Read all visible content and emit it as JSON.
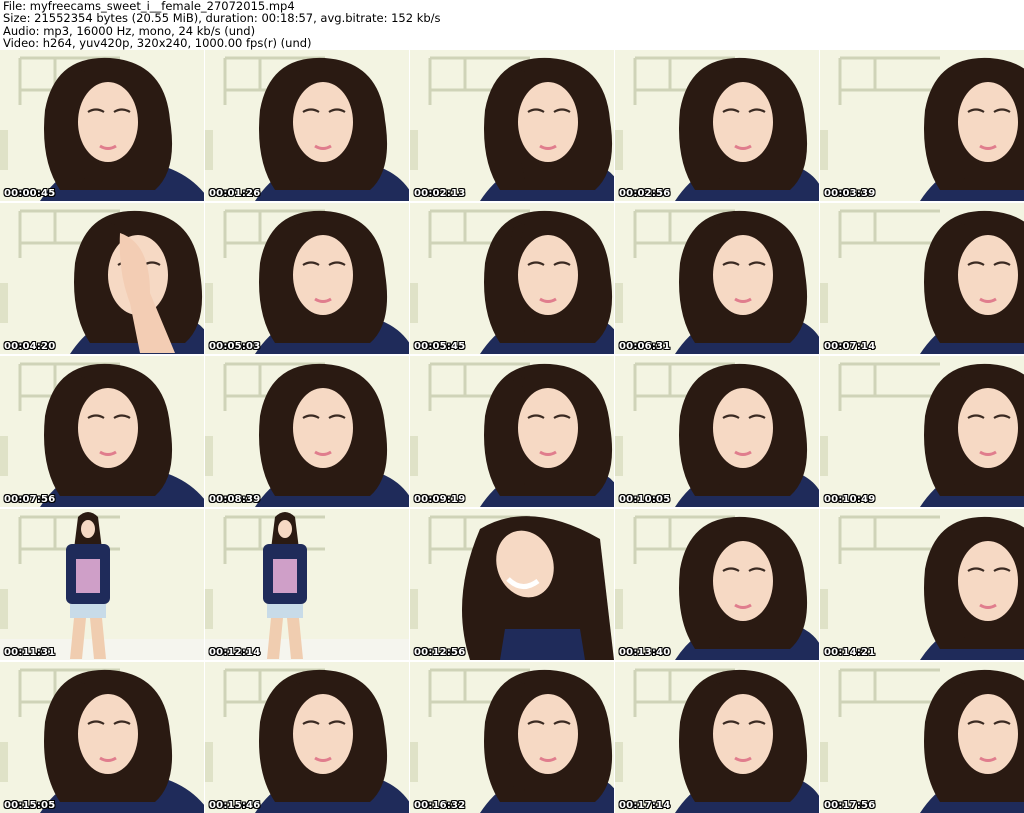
{
  "header": {
    "file_line": "File: myfreecams_sweet_i__female_27072015.mp4",
    "size_line": "Size: 21552354 bytes (20.55 MiB), duration: 00:18:57, avg.bitrate: 152 kb/s",
    "audio_line": "Audio: mp3, 16000 Hz, mono, 24 kb/s (und)",
    "video_line": "Video: h264, yuv420p, 320x240, 1000.00 fps(r) (und)"
  },
  "colors": {
    "background": "#ffffff",
    "wall": "#f3f4e2",
    "hair": "#2a1a12",
    "skin": "#f6d9c4",
    "shirt": "#1f2b5a",
    "timestamp_text": "#ffffff",
    "timestamp_outline": "#000000"
  },
  "thumbnails": [
    {
      "timestamp": "00:00:45",
      "scene": "closeup"
    },
    {
      "timestamp": "00:01:26",
      "scene": "closeup"
    },
    {
      "timestamp": "00:02:13",
      "scene": "closeup"
    },
    {
      "timestamp": "00:02:56",
      "scene": "closeup"
    },
    {
      "timestamp": "00:03:39",
      "scene": "closeup"
    },
    {
      "timestamp": "00:04:20",
      "scene": "closeup-hand"
    },
    {
      "timestamp": "00:05:03",
      "scene": "closeup"
    },
    {
      "timestamp": "00:05:45",
      "scene": "closeup"
    },
    {
      "timestamp": "00:06:31",
      "scene": "closeup"
    },
    {
      "timestamp": "00:07:14",
      "scene": "closeup"
    },
    {
      "timestamp": "00:07:56",
      "scene": "closeup"
    },
    {
      "timestamp": "00:08:39",
      "scene": "closeup"
    },
    {
      "timestamp": "00:09:19",
      "scene": "closeup"
    },
    {
      "timestamp": "00:10:05",
      "scene": "closeup"
    },
    {
      "timestamp": "00:10:49",
      "scene": "closeup"
    },
    {
      "timestamp": "00:11:31",
      "scene": "fullbody"
    },
    {
      "timestamp": "00:12:14",
      "scene": "fullbody"
    },
    {
      "timestamp": "00:12:56",
      "scene": "laughing"
    },
    {
      "timestamp": "00:13:40",
      "scene": "closeup"
    },
    {
      "timestamp": "00:14:21",
      "scene": "closeup"
    },
    {
      "timestamp": "00:15:05",
      "scene": "closeup"
    },
    {
      "timestamp": "00:15:46",
      "scene": "closeup"
    },
    {
      "timestamp": "00:16:32",
      "scene": "closeup"
    },
    {
      "timestamp": "00:17:14",
      "scene": "closeup"
    },
    {
      "timestamp": "00:17:56",
      "scene": "closeup"
    }
  ]
}
